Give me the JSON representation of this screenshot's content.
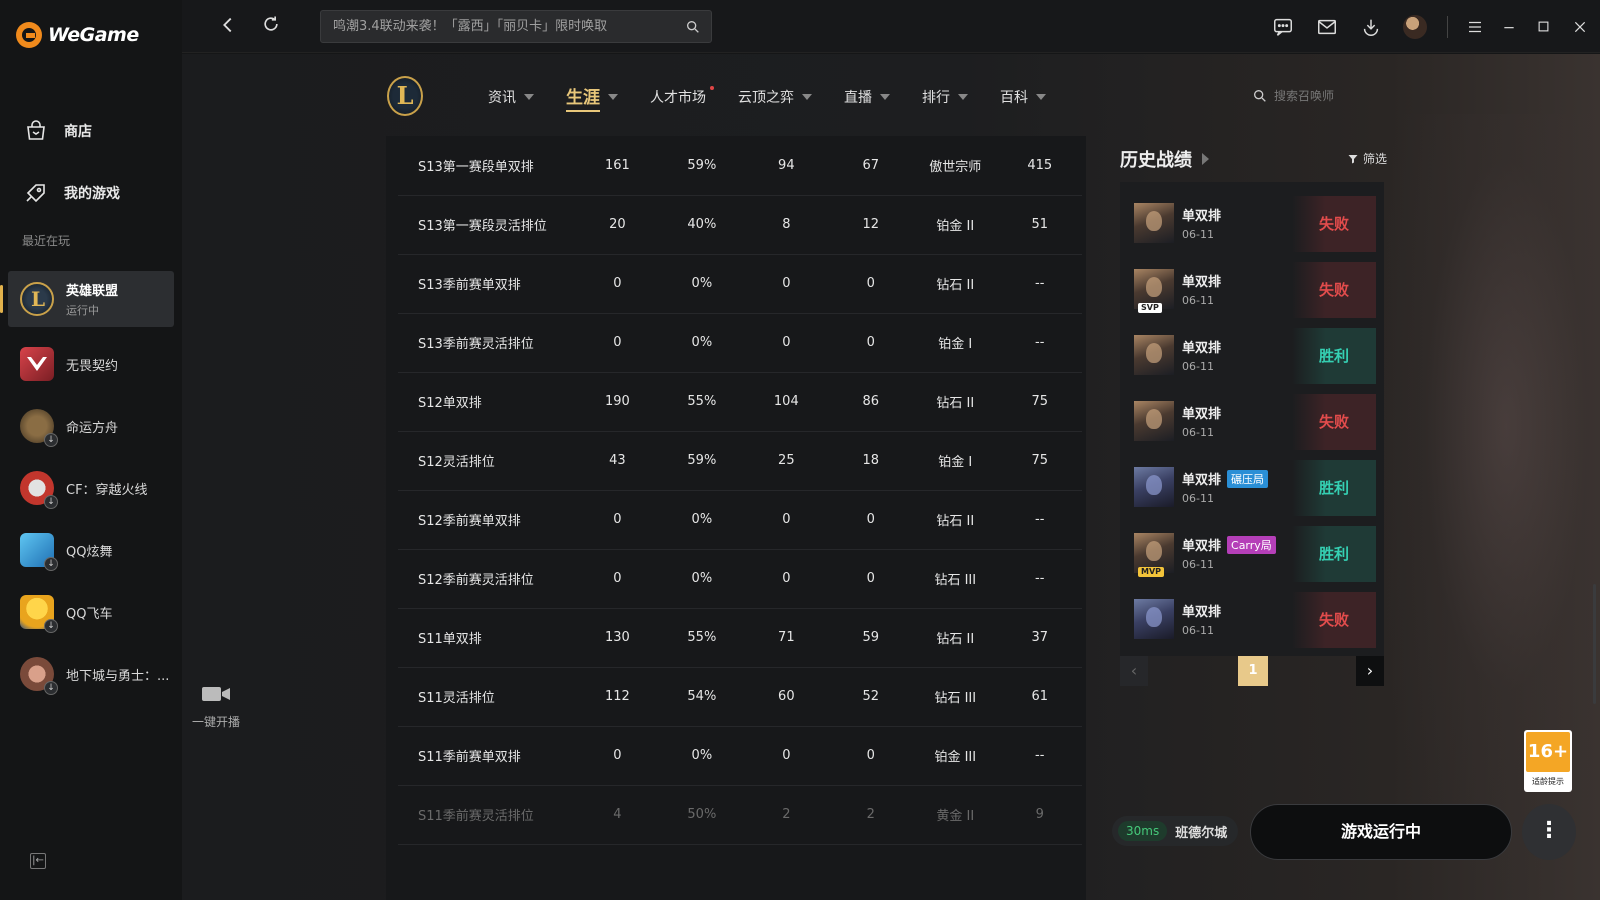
{
  "app": {
    "name": "WeGame"
  },
  "sidebar": {
    "nav": [
      {
        "label": "商店",
        "icon": "store-icon"
      },
      {
        "label": "我的游戏",
        "icon": "my-games-icon"
      }
    ],
    "recent_title": "最近在玩",
    "games": [
      {
        "name": "英雄联盟",
        "status": "运行中",
        "active": true,
        "color": "#1f2a38"
      },
      {
        "name": "无畏契约",
        "status": "",
        "active": false,
        "color": "#c9343a"
      },
      {
        "name": "命运方舟",
        "status": "",
        "active": false,
        "color": "#5a4630"
      },
      {
        "name": "CF：穿越火线",
        "status": "",
        "active": false,
        "color": "#c2362d"
      },
      {
        "name": "QQ炫舞",
        "status": "",
        "active": false,
        "color": "#39a2d8"
      },
      {
        "name": "QQ飞车",
        "status": "",
        "active": false,
        "color": "#f2c230"
      },
      {
        "name": "地下城与勇士：...",
        "status": "",
        "active": false,
        "color": "#8a5b4a"
      }
    ]
  },
  "topbar": {
    "search_placeholder": "鸣潮3.4联动来袭！「露西」「丽贝卡」限时唤取"
  },
  "game_nav": {
    "logo_letter": "L",
    "tabs": [
      {
        "label": "资讯",
        "caret": true,
        "active": false,
        "dot": false
      },
      {
        "label": "生涯",
        "caret": true,
        "active": true,
        "dot": false
      },
      {
        "label": "人才市场",
        "caret": false,
        "active": false,
        "dot": true
      },
      {
        "label": "云顶之弈",
        "caret": true,
        "active": false,
        "dot": false
      },
      {
        "label": "直播",
        "caret": true,
        "active": false,
        "dot": false
      },
      {
        "label": "排行",
        "caret": true,
        "active": false,
        "dot": false
      },
      {
        "label": "百科",
        "caret": true,
        "active": false,
        "dot": false
      }
    ],
    "summoner_search_placeholder": "搜索召唤师"
  },
  "career_table": {
    "rows": [
      [
        "S13第一赛段单双排",
        "161",
        "59%",
        "94",
        "67",
        "傲世宗师",
        "415"
      ],
      [
        "S13第一赛段灵活排位",
        "20",
        "40%",
        "8",
        "12",
        "铂金 II",
        "51"
      ],
      [
        "S13季前赛单双排",
        "0",
        "0%",
        "0",
        "0",
        "钻石 II",
        "--"
      ],
      [
        "S13季前赛灵活排位",
        "0",
        "0%",
        "0",
        "0",
        "铂金 I",
        "--"
      ],
      [
        "S12单双排",
        "190",
        "55%",
        "104",
        "86",
        "钻石 II",
        "75"
      ],
      [
        "S12灵活排位",
        "43",
        "59%",
        "25",
        "18",
        "铂金 I",
        "75"
      ],
      [
        "S12季前赛单双排",
        "0",
        "0%",
        "0",
        "0",
        "钻石 II",
        "--"
      ],
      [
        "S12季前赛灵活排位",
        "0",
        "0%",
        "0",
        "0",
        "钻石 III",
        "--"
      ],
      [
        "S11单双排",
        "130",
        "55%",
        "71",
        "59",
        "钻石 II",
        "37"
      ],
      [
        "S11灵活排位",
        "112",
        "54%",
        "60",
        "52",
        "钻石 III",
        "61"
      ],
      [
        "S11季前赛单双排",
        "0",
        "0%",
        "0",
        "0",
        "铂金 III",
        "--"
      ],
      [
        "S11季前赛灵活排位",
        "4",
        "50%",
        "2",
        "2",
        "黄金 II",
        "9"
      ]
    ]
  },
  "history": {
    "title": "历史战绩",
    "filter_label": "筛选",
    "matches": [
      {
        "mode": "单双排",
        "date": "06-11",
        "result": "失败",
        "win": false,
        "tag": "",
        "badge": "",
        "champ": "warm"
      },
      {
        "mode": "单双排",
        "date": "06-11",
        "result": "失败",
        "win": false,
        "tag": "",
        "badge": "SVP",
        "champ": "warm"
      },
      {
        "mode": "单双排",
        "date": "06-11",
        "result": "胜利",
        "win": true,
        "tag": "",
        "badge": "",
        "champ": "warm"
      },
      {
        "mode": "单双排",
        "date": "06-11",
        "result": "失败",
        "win": false,
        "tag": "",
        "badge": "",
        "champ": "warm"
      },
      {
        "mode": "单双排",
        "date": "06-11",
        "result": "胜利",
        "win": true,
        "tag": "碾压局",
        "tag_color": "blue",
        "badge": "",
        "champ": "blue"
      },
      {
        "mode": "单双排",
        "date": "06-11",
        "result": "胜利",
        "win": true,
        "tag": "Carry局",
        "tag_color": "purple",
        "badge": "MVP",
        "champ": "warm"
      },
      {
        "mode": "单双排",
        "date": "06-11",
        "result": "失败",
        "win": false,
        "tag": "",
        "badge": "",
        "champ": "blue"
      }
    ],
    "page": "1"
  },
  "stream": {
    "label": "一键开播"
  },
  "status": {
    "ping": "30ms",
    "server": "班德尔城"
  },
  "launch_button": "游戏运行中",
  "age_rating": {
    "value": "16+",
    "note": "适龄提示"
  }
}
